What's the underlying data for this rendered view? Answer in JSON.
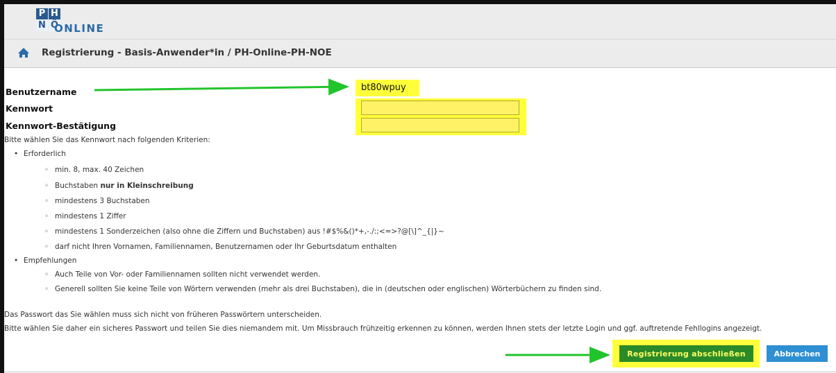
{
  "header": {
    "logo": {
      "p": "P",
      "h": "H",
      "n": "N",
      "o": "Ö",
      "wordmark": "ONLINE"
    },
    "breadcrumb": "Registrierung - Basis-Anwender*in  / PH-Online-PH-NOE",
    "home_icon": "home-icon"
  },
  "form": {
    "username_label": "Benutzername",
    "username_value": "bt80wpuy",
    "password_label": "Kennwort",
    "password_value": "",
    "confirm_label": "Kennwort-Bestätigung",
    "confirm_value": ""
  },
  "criteria": {
    "intro": "Bitte wählen Sie das Kennwort nach folgenden Kriterien:",
    "required_title": "Erforderlich",
    "required": [
      "min. 8, max. 40 Zeichen",
      {
        "prefix": "Buchstaben ",
        "bold": "nur in Kleinschreibung"
      },
      "mindestens 3 Buchstaben",
      "mindestens 1 Ziffer",
      "mindestens 1 Sonderzeichen (also ohne die Ziffern und Buchstaben) aus !#$%&()*+,-./:;<=>?@[\\]^_{|}~",
      "darf nicht Ihren Vornamen, Familiennamen, Benutzernamen oder Ihr Geburtsdatum enthalten"
    ],
    "recommended_title": "Empfehlungen",
    "recommended": [
      "Auch Teile von Vor- oder Familiennamen sollten nicht verwendet werden.",
      "Generell sollten Sie keine Teile von Wörtern verwenden (mehr als drei Buchstaben), die in (deutschen oder englischen) Wörterbüchern zu finden sind."
    ]
  },
  "notes": [
    "Das Passwort das Sie wählen muss sich nicht von früheren Passwörtern unterscheiden.",
    "Bitte wählen Sie daher ein sicheres Passwort und teilen Sie dies niemandem mit. Um Missbrauch frühzeitig erkennen zu können, werden Ihnen stets der letzte Login und ggf. auftretende Fehllogins angezeigt."
  ],
  "buttons": {
    "submit": "Registrierung abschließen",
    "cancel": "Abbrechen"
  },
  "colors": {
    "highlight": "#ffff3a",
    "arrow": "#22c42c",
    "submit_bg": "#2a8a28",
    "cancel_bg": "#2e8fd3",
    "brand": "#2a5a8f"
  }
}
